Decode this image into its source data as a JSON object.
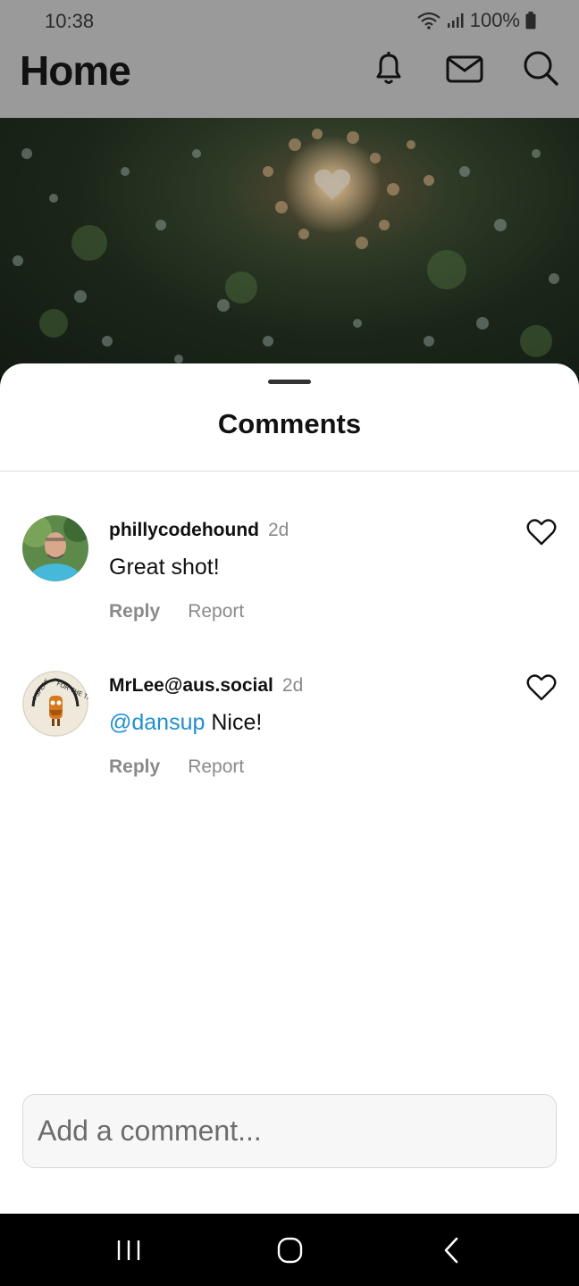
{
  "status_bar": {
    "time": "10:38",
    "battery": "100%"
  },
  "header": {
    "title": "Home",
    "icons": [
      "bell-icon",
      "mail-icon",
      "search-icon"
    ]
  },
  "sheet": {
    "title": "Comments",
    "comments": [
      {
        "username": "phillycodehound",
        "time": "2d",
        "text": "Great shot!",
        "mention": "",
        "reply_label": "Reply",
        "report_label": "Report"
      },
      {
        "username": "MrLee@aus.social",
        "time": "2d",
        "text": "Nice!",
        "mention": "@dansup",
        "reply_label": "Reply",
        "report_label": "Report"
      }
    ],
    "input_placeholder": "Add a comment..."
  },
  "avatar_logo_text": "I SPEAK FOR THE TREES",
  "colors": {
    "mention": "#1e8fd0",
    "muted": "#8a8a8a",
    "sheet_bg": "#ffffff",
    "backdrop": "#9a9a9a"
  }
}
